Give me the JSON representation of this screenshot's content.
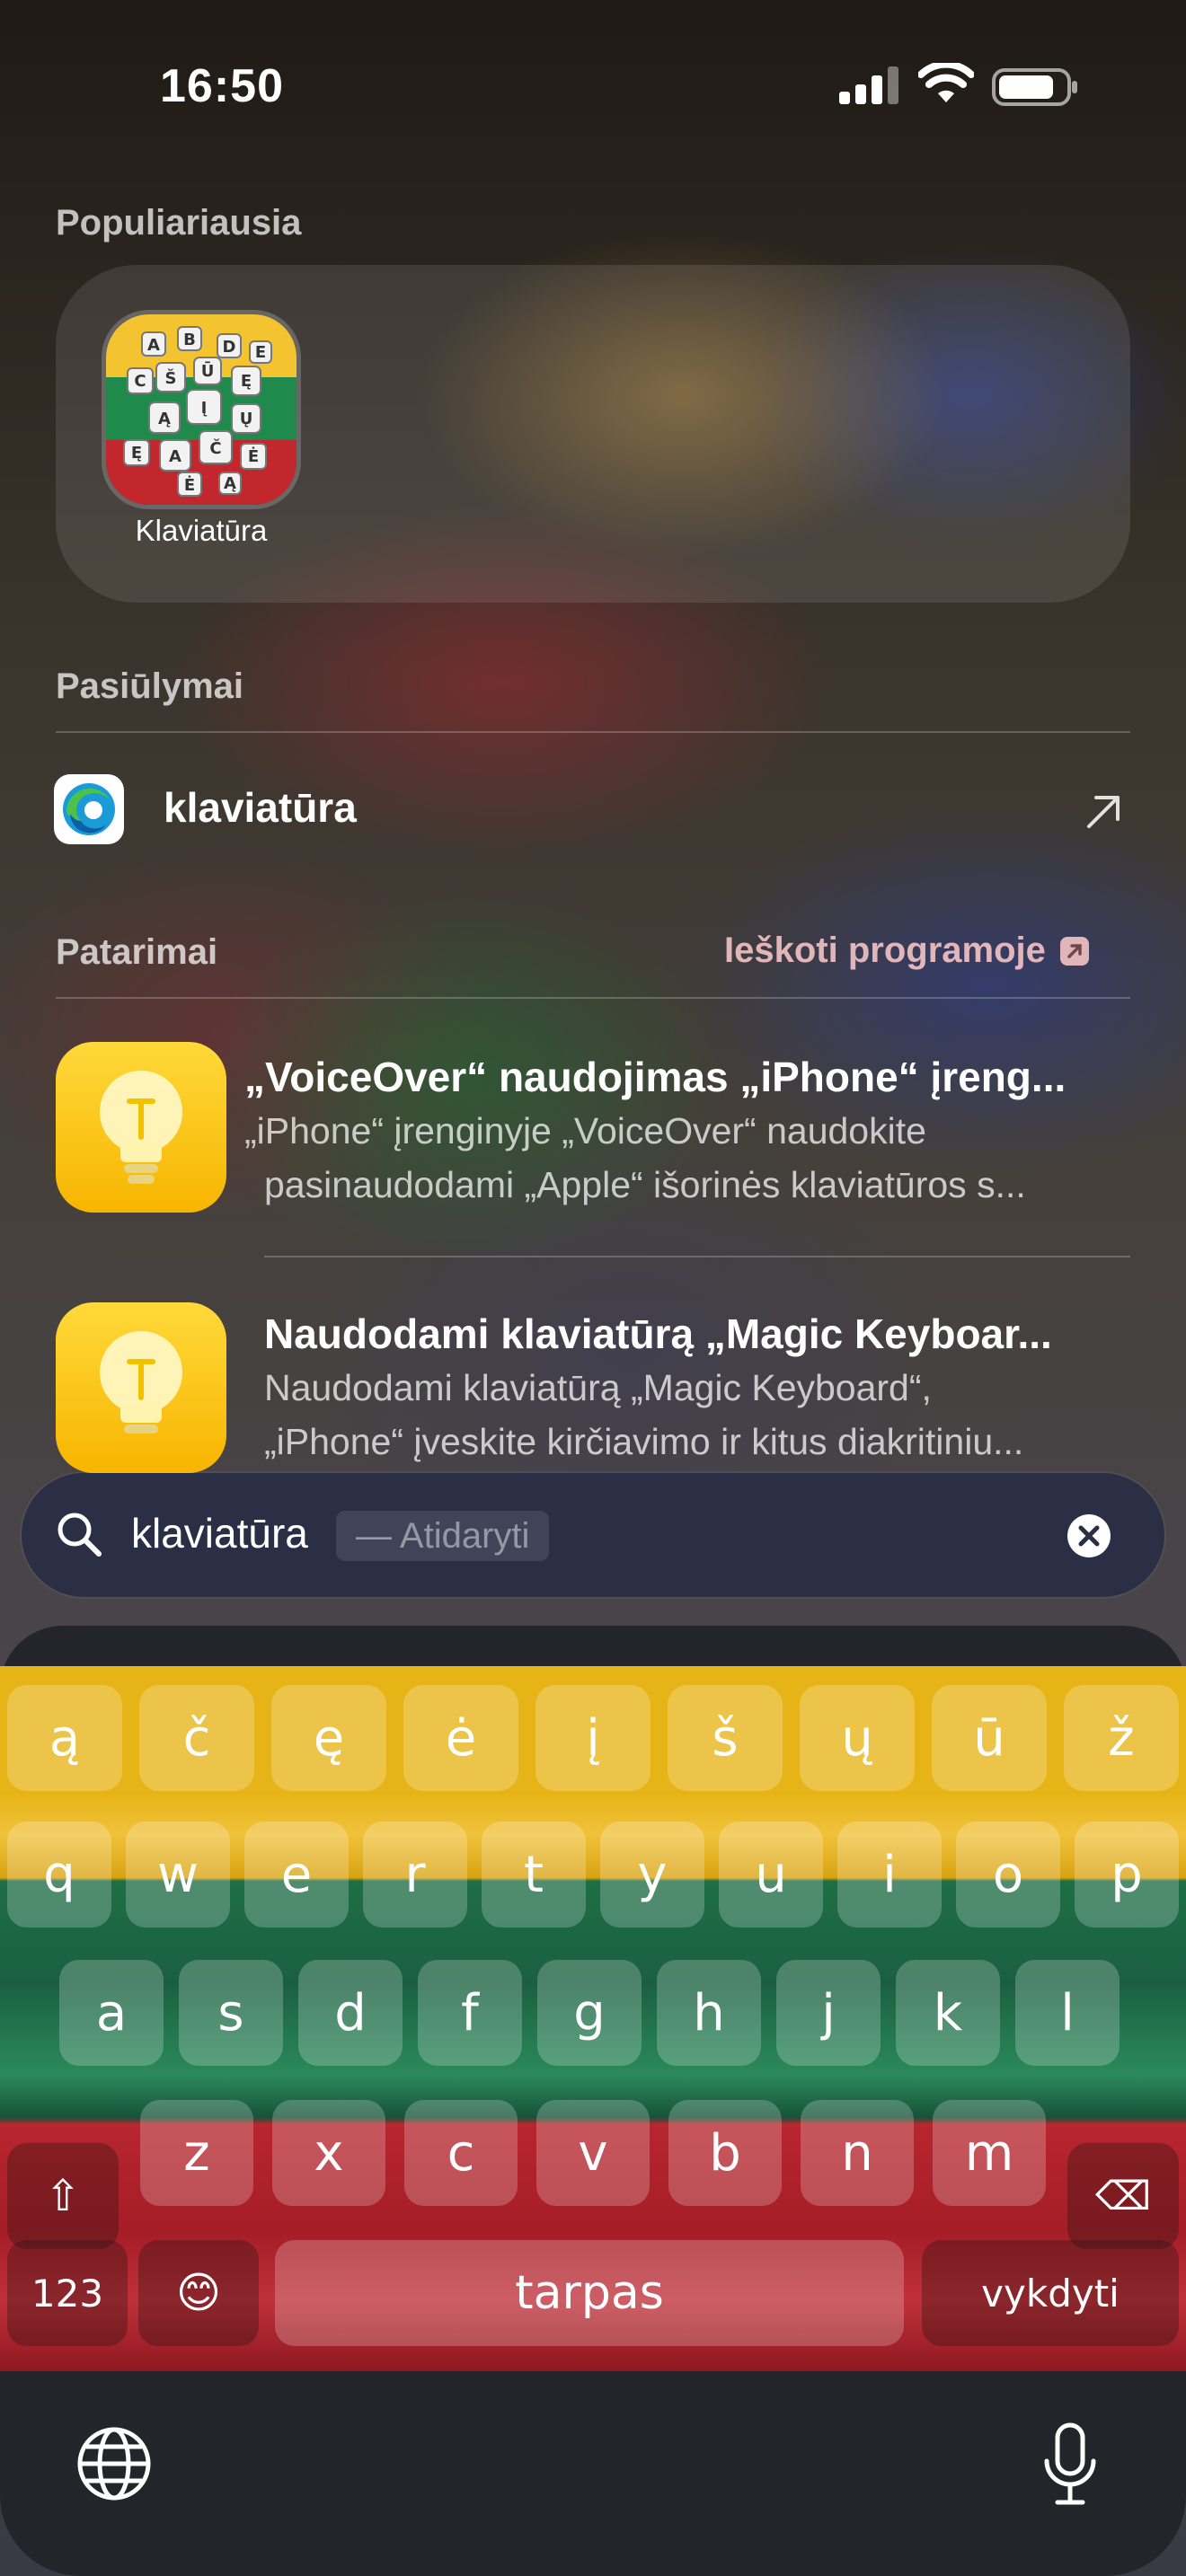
{
  "status_bar": {
    "time": "16:50"
  },
  "popular": {
    "title": "Populiariausia",
    "app_label": "Klaviatūra",
    "icon_letters": [
      "A",
      "B",
      "C",
      "D",
      "E",
      "Š",
      "Ū",
      "Į",
      "Ą",
      "Č",
      "Ę",
      "Ų",
      "Ė"
    ]
  },
  "suggestions": {
    "title": "Pasiūlymai",
    "item_label": "klaviatūra"
  },
  "tips": {
    "title": "Patarimai",
    "search_in_app": "Ieškoti programoje",
    "items": [
      {
        "title": "„VoiceOver“ naudojimas „iPhone“ įreng...",
        "line1": "„iPhone“ įrenginyje „VoiceOver“ naudokite",
        "line2": "pasinaudodami „Apple“ išorinės klaviatūros s..."
      },
      {
        "title": "Naudodami klaviatūrą „Magic Keyboar...",
        "line1": "Naudodami klaviatūrą „Magic Keyboard“,",
        "line2": "„iPhone“ įveskite kirčiavimo ir kitus diakritiniu..."
      }
    ]
  },
  "search": {
    "query": "klaviatūra",
    "open_hint": "— Atidaryti"
  },
  "keyboard": {
    "row1": [
      "ą",
      "č",
      "ę",
      "ė",
      "į",
      "š",
      "ų",
      "ū",
      "ž"
    ],
    "row2": [
      "q",
      "w",
      "e",
      "r",
      "t",
      "y",
      "u",
      "i",
      "o",
      "p"
    ],
    "row3": [
      "a",
      "s",
      "d",
      "f",
      "g",
      "h",
      "j",
      "k",
      "l"
    ],
    "row4": [
      "z",
      "x",
      "c",
      "v",
      "b",
      "n",
      "m"
    ],
    "numbers": "123",
    "emoji": "😊",
    "space": "tarpas",
    "go": "vykdyti",
    "shift_glyph": "⇧",
    "delete_glyph": "⌫"
  },
  "colors": {
    "flag_yellow": "#e7b417",
    "flag_green": "#1e6e46",
    "flag_red": "#b8262e",
    "tip_icon": "#f7b500"
  }
}
